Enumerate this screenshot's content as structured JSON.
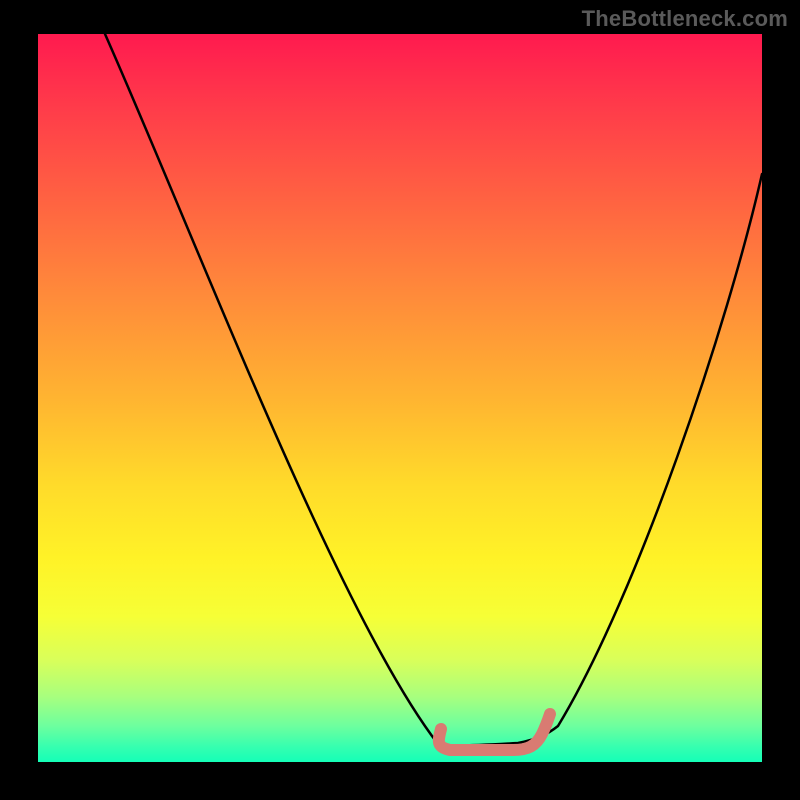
{
  "watermark": "TheBottleneck.com",
  "chart_data": {
    "type": "line",
    "title": "",
    "xlabel": "",
    "ylabel": "",
    "xlim": [
      0,
      100
    ],
    "ylim": [
      0,
      100
    ],
    "grid": false,
    "legend": false,
    "background": {
      "gradient_top_color": "#ff1a4f",
      "gradient_mid_color": "#fff227",
      "gradient_bottom_color": "#14ffb7"
    },
    "series": [
      {
        "name": "curve",
        "color": "#000000",
        "x": [
          9,
          20,
          30,
          40,
          50,
          55,
          60,
          66,
          72,
          80,
          90,
          100
        ],
        "y": [
          100,
          72,
          45,
          25,
          10,
          4,
          2,
          3,
          8,
          25,
          55,
          80
        ]
      },
      {
        "name": "trough-highlight",
        "color": "#d97b72",
        "x": [
          56,
          58,
          60,
          62,
          64,
          66,
          68,
          70
        ],
        "y": [
          4,
          2.5,
          2,
          2,
          2,
          2.5,
          3.5,
          6
        ]
      }
    ],
    "annotations": []
  }
}
